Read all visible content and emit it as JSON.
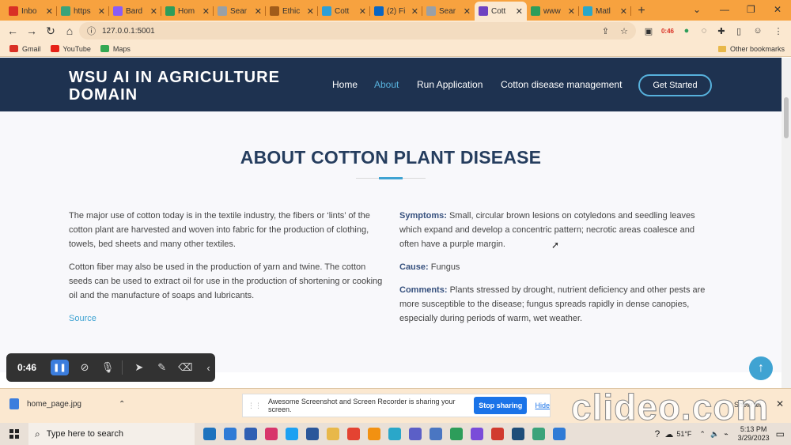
{
  "browser": {
    "tabs": [
      {
        "label": "Inbo",
        "color": "#d93025"
      },
      {
        "label": "https",
        "color": "#3aa37a"
      },
      {
        "label": "Bard",
        "color": "#8a5cf6"
      },
      {
        "label": "Hom",
        "color": "#2d9d5a"
      },
      {
        "label": "Sear",
        "color": "#9aa0a6"
      },
      {
        "label": "Ethic",
        "color": "#a15c1a"
      },
      {
        "label": "Cott",
        "color": "#2e9fd6"
      },
      {
        "label": "(2) Fi",
        "color": "#0a66c2"
      },
      {
        "label": "Sear",
        "color": "#9aa0a6"
      },
      {
        "label": "Cott",
        "color": "#6f42c1"
      },
      {
        "label": "www",
        "color": "#2d9d5a"
      },
      {
        "label": "Matl",
        "color": "#2aa7c9"
      }
    ],
    "active_tab_index": 9,
    "new_tab": "+",
    "url": "127.0.0.1:5001",
    "bookmarks": [
      {
        "label": "Gmail",
        "color": "#d93025"
      },
      {
        "label": "YouTube",
        "color": "#e62117"
      },
      {
        "label": "Maps",
        "color": "#34a853"
      }
    ],
    "other_bookmarks": "Other bookmarks",
    "profile_badge": "0:46"
  },
  "site": {
    "logo": "WSU AI IN AGRICULTURE DOMAIN",
    "nav": {
      "home": "Home",
      "about": "About",
      "run": "Run Application",
      "management": "Cotton disease management"
    },
    "cta": "Get Started"
  },
  "about": {
    "title": "ABOUT COTTON PLANT DISEASE",
    "left_p1": "The major use of cotton today is in the textile industry, the fibers or ‘lints’ of the cotton plant are harvested and woven into fabric for the production of clothing, towels, bed sheets and many other textiles.",
    "left_p2": "Cotton fiber may also be used in the production of yarn and twine. The cotton seeds can be used to extract oil for use in the production of shortening or cooking oil and the manufacture of soaps and lubricants.",
    "source": "Source",
    "symptoms_label": "Symptoms:",
    "symptoms_text": " Small, circular brown lesions on cotyledons and seedling leaves which expand and develop a concentric pattern; necrotic areas coalesce and often have a purple margin.",
    "cause_label": "Cause:",
    "cause_text": " Fungus",
    "comments_label": "Comments:",
    "comments_text": " Plants stressed by drought, nutrient deficiency and other pests are more susceptible to the disease; fungus spreads rapidly in dense canopies, especially during periods of warm, wet weather."
  },
  "recorder": {
    "time": "0:46"
  },
  "downloads": {
    "file": "home_page.jpg",
    "share_text": "Awesome Screenshot and Screen Recorder is sharing your screen.",
    "stop_label": "Stop sharing",
    "hide_label": "Hide",
    "show_all": "Show all",
    "watermark": "clideo.com"
  },
  "taskbar": {
    "search_placeholder": "Type here to search",
    "weather": "51°F",
    "time": "5:13 PM",
    "date": "3/29/2023",
    "icons": [
      "#1e73be",
      "#2f7bd6",
      "#2f5fb3",
      "#d8356b",
      "#1da1f2",
      "#2b579a",
      "#e8b84a",
      "#e44332",
      "#f29111",
      "#2aa7c9",
      "#5b5fc7",
      "#4a76c2",
      "#2d9d5a",
      "#7a4cd9",
      "#d13b2f",
      "#1f4e79",
      "#3aa37a",
      "#2f7bd6"
    ]
  }
}
